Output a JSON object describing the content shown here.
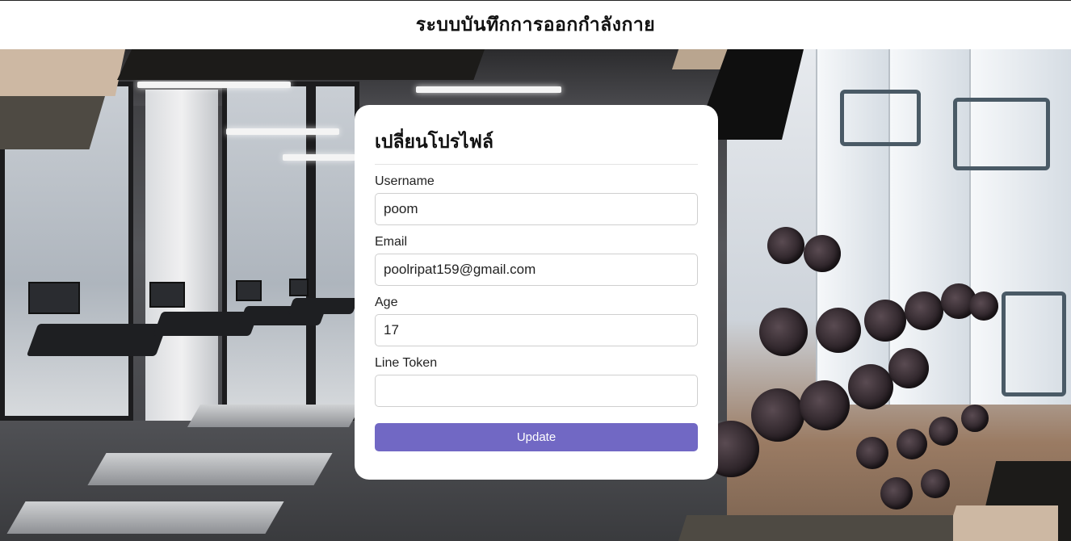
{
  "header": {
    "title": "ระบบบันทึกการออกกำลังกาย"
  },
  "profile_form": {
    "title": "เปลี่ยนโปรไฟล์",
    "fields": [
      {
        "label": "Username",
        "value": "poom",
        "placeholder": ""
      },
      {
        "label": "Email",
        "value": "poolripat159@gmail.com",
        "placeholder": ""
      },
      {
        "label": "Age",
        "value": "17",
        "placeholder": ""
      },
      {
        "label": "Line Token",
        "value": "",
        "placeholder": ""
      }
    ],
    "submit_label": "Update"
  },
  "colors": {
    "accent": "#7168c4",
    "card_background": "#ffffff",
    "header_background": "#ffffff",
    "tan_stripe": "#cdb8a3",
    "dark_stripe": "#1c1b19"
  },
  "background": {
    "description_icon": "gym-background-image"
  }
}
